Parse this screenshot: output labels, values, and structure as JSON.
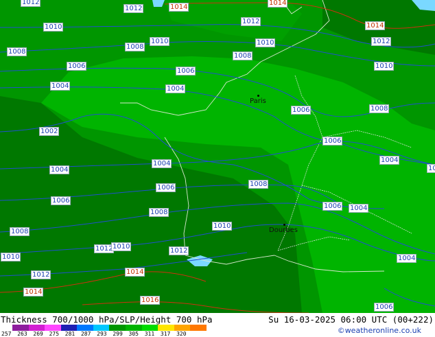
{
  "title": "Thickness 700/1000 hPa/SLP/Height 700 hPa",
  "timestamp": "Su 16-03-2025 06:00 UTC (00+222)",
  "copyright": "©weatheronline.co.uk",
  "legend": {
    "ticks": [
      "257",
      "263",
      "269",
      "275",
      "281",
      "287",
      "293",
      "299",
      "305",
      "311",
      "317",
      "320"
    ],
    "colors": [
      "#8e1e9e",
      "#d21ed2",
      "#ff46ff",
      "#1e1eb4",
      "#0078ff",
      "#00c8ff",
      "#009600",
      "#00b400",
      "#00dc00",
      "#ffe600",
      "#ffa500",
      "#ff7800"
    ]
  },
  "colors": {
    "dark_green": "#007800",
    "mid_green": "#009600",
    "light_green": "#00b400",
    "isobar": "#2050d0",
    "isobar_high": "#d03010"
  },
  "cities": [
    {
      "name": "Paris"
    },
    {
      "name": "Dourbes"
    }
  ],
  "isobar_labels": [
    {
      "text": "1012"
    },
    {
      "text": "1012"
    },
    {
      "text": "1014"
    },
    {
      "text": "1014"
    },
    {
      "text": "1010"
    },
    {
      "text": "1012"
    },
    {
      "text": "1014"
    },
    {
      "text": "1008"
    },
    {
      "text": "1010"
    },
    {
      "text": "1010"
    },
    {
      "text": "1012"
    },
    {
      "text": "1008"
    },
    {
      "text": "1008"
    },
    {
      "text": "1006"
    },
    {
      "text": "1006"
    },
    {
      "text": "1010"
    },
    {
      "text": "1004"
    },
    {
      "text": "1004"
    },
    {
      "text": "1006"
    },
    {
      "text": "1008"
    },
    {
      "text": "1002"
    },
    {
      "text": "1006"
    },
    {
      "text": "1004"
    },
    {
      "text": "1004"
    },
    {
      "text": "1006"
    },
    {
      "text": "1008"
    },
    {
      "text": "1006"
    },
    {
      "text": "1004"
    },
    {
      "text": "1008"
    },
    {
      "text": "1010"
    },
    {
      "text": "1008"
    },
    {
      "text": "1012"
    },
    {
      "text": "1010"
    },
    {
      "text": "1012"
    },
    {
      "text": "1010"
    },
    {
      "text": "1014"
    },
    {
      "text": "1012"
    },
    {
      "text": "1014"
    },
    {
      "text": "1016"
    },
    {
      "text": "1004"
    },
    {
      "text": "1006"
    },
    {
      "text": "1004"
    },
    {
      "text": "1006"
    },
    {
      "text": "10"
    }
  ]
}
